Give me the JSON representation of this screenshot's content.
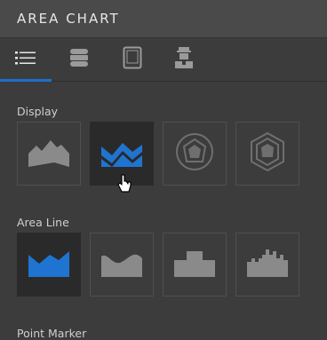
{
  "header": {
    "title": "AREA CHART"
  },
  "tabs": [
    {
      "name": "list-icon",
      "active": true
    },
    {
      "name": "database-icon",
      "active": false
    },
    {
      "name": "tablet-icon",
      "active": false
    },
    {
      "name": "user-icon",
      "active": false
    }
  ],
  "sections": {
    "display": {
      "label": "Display",
      "options": [
        {
          "icon": "mountain-icon",
          "selected": false
        },
        {
          "icon": "area-chart-icon",
          "selected": true
        },
        {
          "icon": "radar-circle-icon",
          "selected": false
        },
        {
          "icon": "radar-hexagon-icon",
          "selected": false
        }
      ]
    },
    "area_line": {
      "label": "Area Line",
      "options": [
        {
          "icon": "straight-line-area-icon",
          "selected": true
        },
        {
          "icon": "curved-line-area-icon",
          "selected": false
        },
        {
          "icon": "step-line-area-icon",
          "selected": false
        },
        {
          "icon": "segmented-step-area-icon",
          "selected": false
        }
      ]
    },
    "point_marker": {
      "label": "Point Marker"
    }
  },
  "colors": {
    "accent": "#1a6fd0",
    "selected_fill": "#1f74d1",
    "unselected_fill": "#8a8a8a"
  }
}
